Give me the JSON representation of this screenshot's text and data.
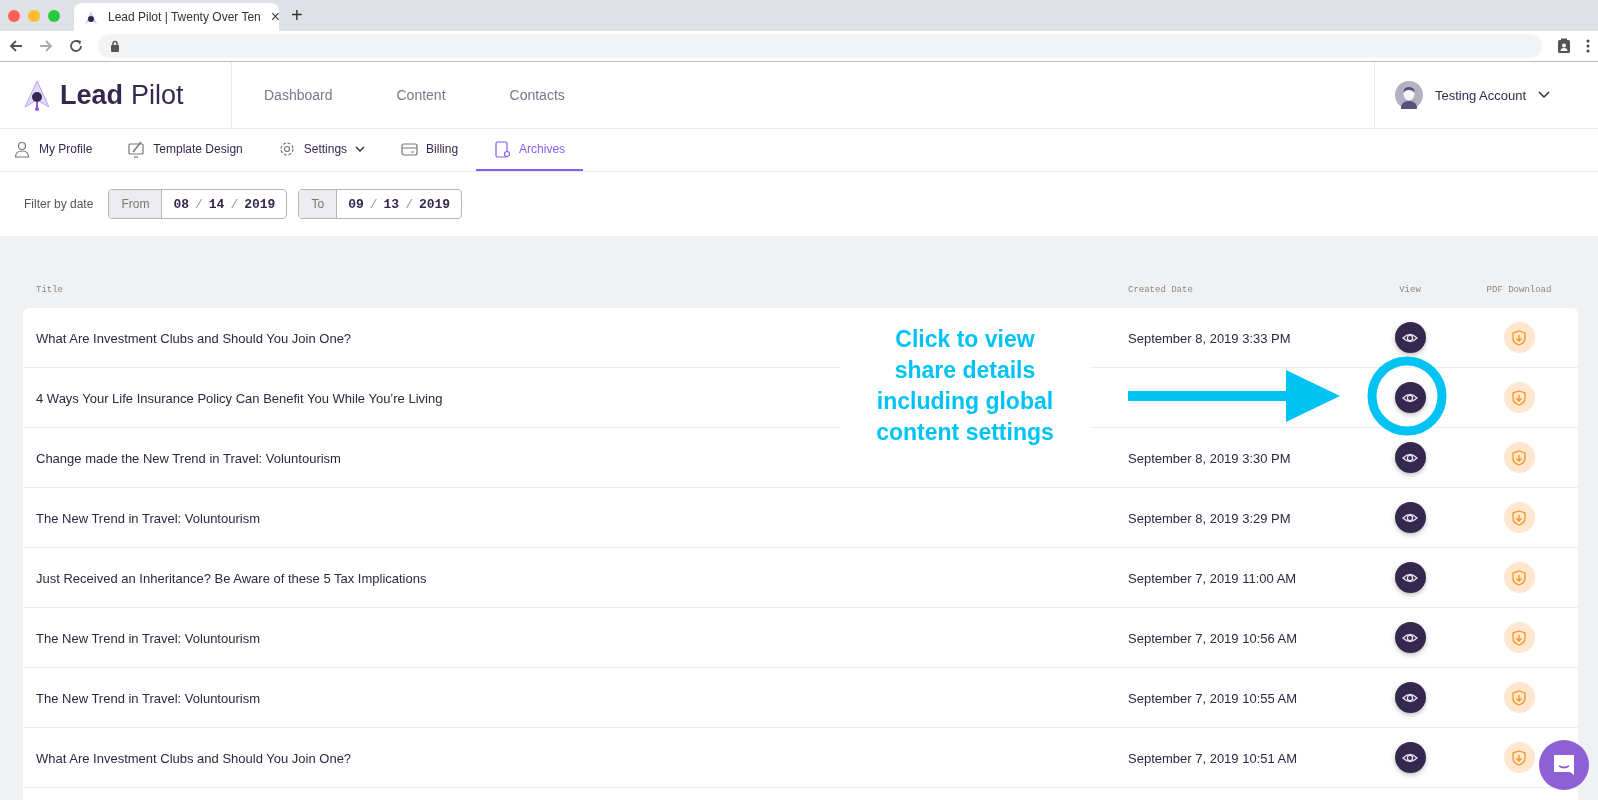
{
  "browser": {
    "tab_title": "Lead Pilot | Twenty Over Ten",
    "close": "×",
    "new_tab": "+"
  },
  "header": {
    "logo_bold": "Lead",
    "logo_light": "Pilot",
    "nav": [
      {
        "label": "Dashboard"
      },
      {
        "label": "Content"
      },
      {
        "label": "Contacts"
      }
    ],
    "account": "Testing Account"
  },
  "subnav": [
    {
      "label": "My Profile",
      "kind": "person",
      "selected": false,
      "dropdown": false
    },
    {
      "label": "Template Design",
      "kind": "design",
      "selected": false,
      "dropdown": false
    },
    {
      "label": "Settings",
      "kind": "gear",
      "selected": false,
      "dropdown": true
    },
    {
      "label": "Billing",
      "kind": "card",
      "selected": false,
      "dropdown": false
    },
    {
      "label": "Archives",
      "kind": "archive",
      "selected": true,
      "dropdown": false
    }
  ],
  "filter": {
    "label": "Filter by date",
    "from": {
      "label": "From",
      "month": "08",
      "day": "14",
      "year": "2019"
    },
    "to": {
      "label": "To",
      "month": "09",
      "day": "13",
      "year": "2019"
    },
    "separator": "/"
  },
  "table": {
    "columns": [
      "Title",
      "Created Date",
      "View",
      "PDF Download"
    ],
    "rows": [
      {
        "title": "What Are Investment Clubs and Should You Join One?",
        "date": "September 8, 2019 3:33 PM"
      },
      {
        "title": "4 Ways Your Life Insurance Policy Can Benefit You While You’re Living"
      },
      {
        "title": "Change made the New Trend in Travel: Voluntourism",
        "date": "September 8, 2019 3:30 PM"
      },
      {
        "title": "The New Trend in Travel: Voluntourism",
        "date": "September 8, 2019 3:29 PM"
      },
      {
        "title": "Just Received an Inheritance? Be Aware of these 5 Tax Implications",
        "date": "September 7, 2019 11:00 AM"
      },
      {
        "title": "The New Trend in Travel: Voluntourism",
        "date": "September 7, 2019 10:56 AM"
      },
      {
        "title": "The New Trend in Travel: Voluntourism",
        "date": "September 7, 2019 10:55 AM"
      },
      {
        "title": "What Are Investment Clubs and Should You Join One?",
        "date": "September 7, 2019 10:51 AM"
      },
      {}
    ]
  },
  "annotation": {
    "text": "Click to view share details including global content settings"
  }
}
